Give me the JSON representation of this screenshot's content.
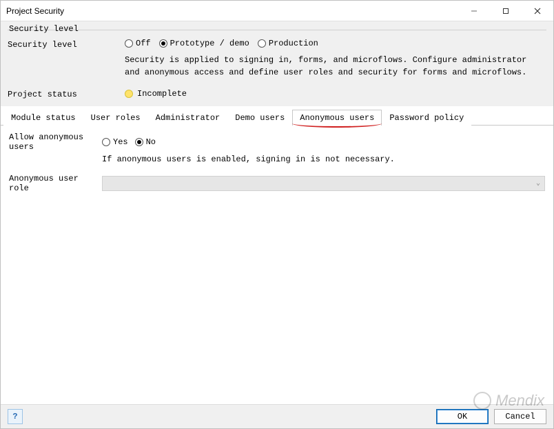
{
  "window": {
    "title": "Project Security"
  },
  "group": {
    "title": "Security level",
    "level": {
      "label": "Security level",
      "options": {
        "off": "Off",
        "prototype": "Prototype / demo",
        "production": "Production"
      },
      "selected": "prototype",
      "description": "Security is applied to signing in, forms, and microflows. Configure administrator and anonymous access and define user roles and security for forms and microflows."
    },
    "status": {
      "label": "Project status",
      "value": "Incomplete"
    }
  },
  "tabs": {
    "items": [
      {
        "id": "module-status",
        "label": "Module status"
      },
      {
        "id": "user-roles",
        "label": "User roles"
      },
      {
        "id": "administrator",
        "label": "Administrator"
      },
      {
        "id": "demo-users",
        "label": "Demo users"
      },
      {
        "id": "anonymous-users",
        "label": "Anonymous users"
      },
      {
        "id": "password-policy",
        "label": "Password policy"
      }
    ],
    "active": "anonymous-users"
  },
  "anon": {
    "allow_label": "Allow anonymous users",
    "options": {
      "yes": "Yes",
      "no": "No"
    },
    "selected": "no",
    "hint": "If anonymous users is enabled, signing in is not necessary.",
    "role_label": "Anonymous user role",
    "role_value": ""
  },
  "footer": {
    "ok": "OK",
    "cancel": "Cancel"
  },
  "watermark": "Mendix"
}
